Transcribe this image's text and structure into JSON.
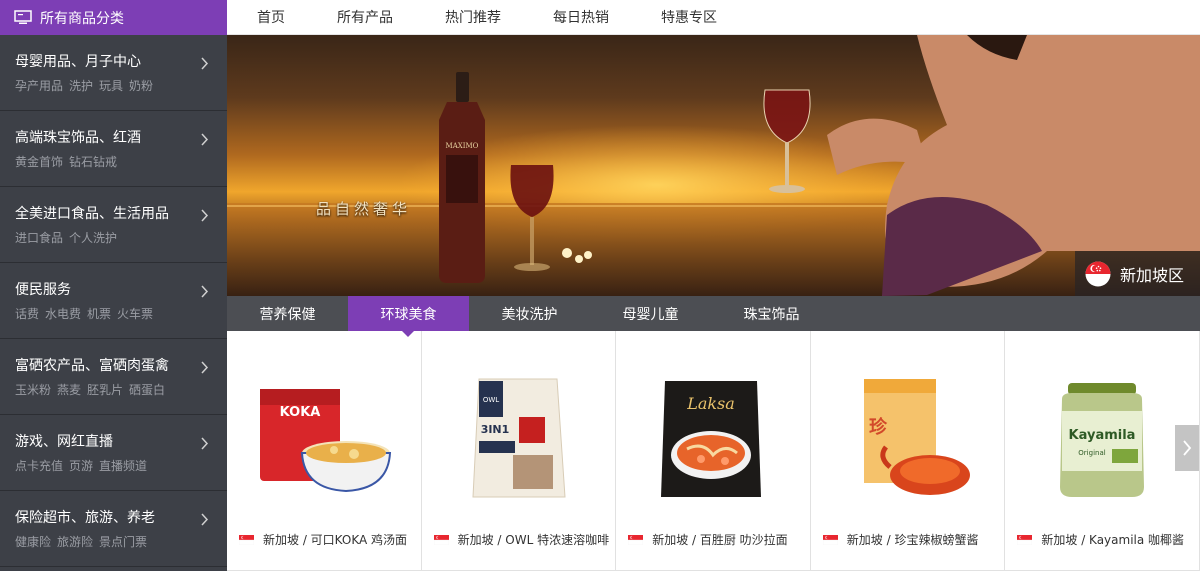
{
  "sidebar": {
    "heading": "所有商品分类",
    "heading_icon": "monitor-icon",
    "categories": [
      {
        "title": "母婴用品、月子中心",
        "subs": [
          "孕产用品",
          "洗护",
          "玩具",
          "奶粉"
        ]
      },
      {
        "title": "高端珠宝饰品、红酒",
        "subs": [
          "黄金首饰",
          "钻石钻戒"
        ]
      },
      {
        "title": "全美进口食品、生活用品",
        "subs": [
          "进口食品",
          "个人洗护"
        ]
      },
      {
        "title": "便民服务",
        "subs": [
          "话费",
          "水电费",
          "机票",
          "火车票"
        ]
      },
      {
        "title": "富硒农产品、富硒肉蛋禽",
        "subs": [
          "玉米粉",
          "燕麦",
          "胚乳片",
          "硒蛋白"
        ]
      },
      {
        "title": "游戏、网红直播",
        "subs": [
          "点卡充值",
          "页游",
          "直播频道"
        ]
      },
      {
        "title": "保险超市、旅游、养老",
        "subs": [
          "健康险",
          "旅游险",
          "景点门票"
        ]
      }
    ]
  },
  "topnav": [
    "首页",
    "所有产品",
    "热门推荐",
    "每日热销",
    "特惠专区"
  ],
  "banner": {
    "slogan": "品自然奢华",
    "bottle_label": "MAXIMO",
    "region": "新加坡区",
    "region_icon": "singapore-flag-icon"
  },
  "tabs": [
    "营养保健",
    "环球美食",
    "美妆洗护",
    "母婴儿童",
    "珠宝饰品"
  ],
  "active_tab": 1,
  "products": [
    {
      "caption": "新加坡 / 可口KOKA 鸡汤面",
      "pkg_text": "KOKA"
    },
    {
      "caption": "新加坡 / OWL 特浓速溶咖啡",
      "pkg_text": "OWL",
      "pkg_text2": "3IN1"
    },
    {
      "caption": "新加坡 / 百胜厨 叻沙拉面",
      "pkg_text": "Laksa"
    },
    {
      "caption": "新加坡 / 珍宝辣椒螃蟹酱",
      "pkg_text": "珍"
    },
    {
      "caption": "新加坡 / Kayamila 咖椰酱",
      "pkg_text": "Kayamila",
      "pkg_text2": "Original"
    }
  ],
  "colors": {
    "accent": "#7d3eb5",
    "sidebar_bg": "#3d4047",
    "tab_bar": "#4c4e53"
  }
}
